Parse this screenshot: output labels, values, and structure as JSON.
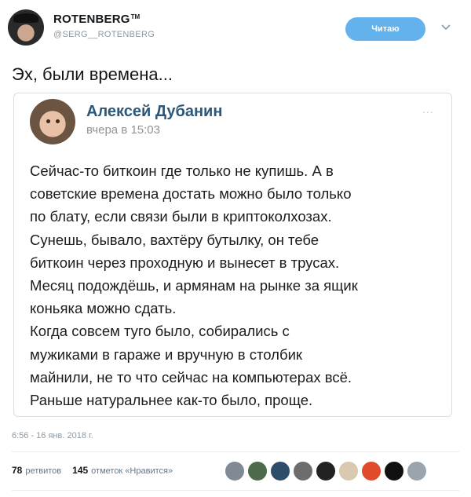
{
  "author": {
    "name": "ROTENBERG",
    "trademark": "TM",
    "handle": "@SERG__ROTENBERG"
  },
  "follow_button": {
    "label": "Читаю"
  },
  "icons": {
    "more": "chevron-down-icon"
  },
  "tweet": {
    "text": "Эх, были времена..."
  },
  "quoted_post": {
    "author_name": "Алексей Дубанин",
    "time": "вчера в 15:03",
    "more": "...",
    "lines": [
      "Сейчас-то биткоин где только не купишь. А в",
      "советские времена достать можно было только",
      "по блату, если связи были в криптоколхозах.",
      "Сунешь, бывало, вахтёру бутылку, он тебе",
      "биткоин через проходную и вынесет в трусах.",
      "Месяц подождёшь, и армянам на рынке за ящик",
      "коньяка можно сдать.",
      "Когда совсем туго было, собирались с",
      "мужиками в гараже и вручную в столбик",
      "майнили, не то что сейчас на компьютерах всё.",
      "Раньше натуральнее как-то было, проще."
    ]
  },
  "timestamp": "6:56 - 16 янв. 2018 г.",
  "stats": {
    "retweets_count": "78",
    "retweets_label": "ретвитов",
    "likes_count": "145",
    "likes_label": "отметок «Нравится»"
  },
  "likers": [
    "#7f8a94",
    "#4b6b4a",
    "#2e4d6b",
    "#6d6d6d",
    "#222222",
    "#d8c9b0",
    "#e04b2b",
    "#111111",
    "#9aa4ad"
  ],
  "colors": {
    "accent": "#63b2ec",
    "vk_name": "#2b587a",
    "muted": "#8899a6"
  }
}
